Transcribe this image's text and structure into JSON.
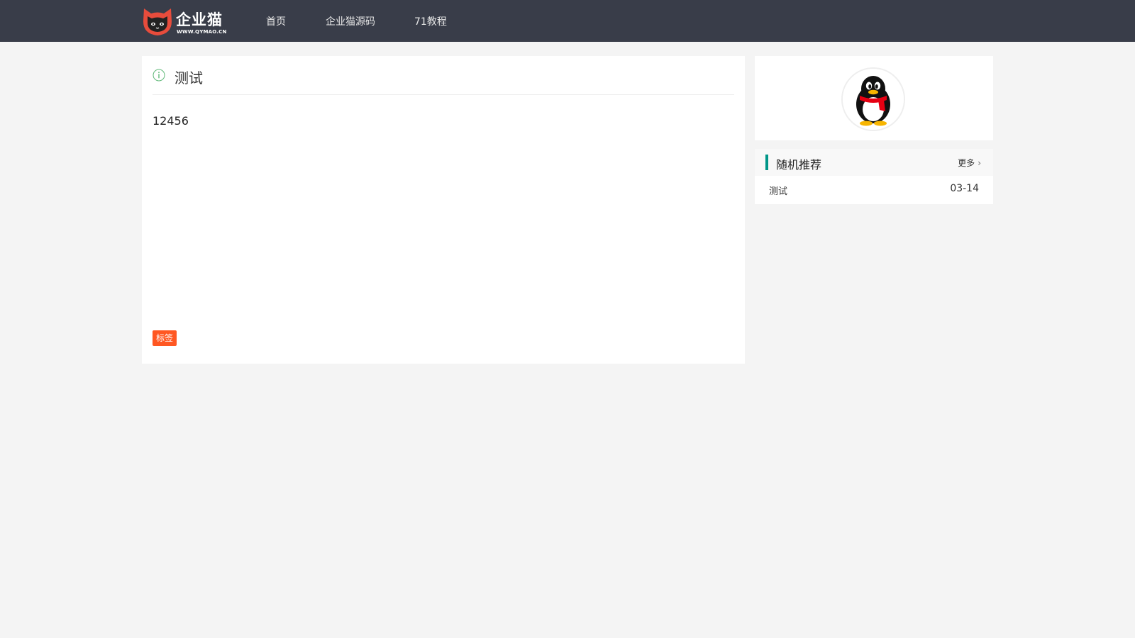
{
  "header": {
    "logo": {
      "name": "企业猫",
      "url": "WWW.QYMAO.CN"
    },
    "nav": [
      {
        "label": "首页"
      },
      {
        "label": "企业猫源码"
      },
      {
        "label": "71教程"
      }
    ]
  },
  "article": {
    "title": "测试",
    "content": "12456",
    "tag": "标签"
  },
  "sidebar": {
    "recommend": {
      "title": "随机推荐",
      "more_label": "更多",
      "items": [
        {
          "title": "测试",
          "date": "03-14"
        }
      ]
    }
  },
  "colors": {
    "header_bg": "#393d49",
    "page_bg": "#f4f4f4",
    "accent": "#009688",
    "tag_bg": "#ff5722",
    "logo_red": "#e74c3c"
  }
}
